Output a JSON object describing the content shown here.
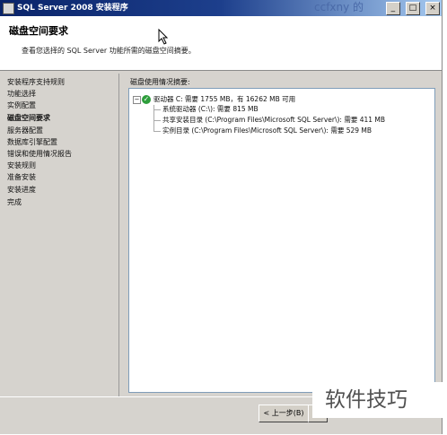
{
  "window": {
    "title": "SQL Server 2008 安装程序",
    "controls": [
      "_",
      "□",
      "×"
    ]
  },
  "watermark": {
    "top": "ccfxny 的 ",
    "bottom": "软件技巧"
  },
  "header": {
    "title": "磁盘空间要求",
    "subtitle": "查看您选择的 SQL Server 功能所需的磁盘空间摘要。"
  },
  "sidebar": {
    "items": [
      {
        "label": "安装程序支持规则",
        "active": false
      },
      {
        "label": "功能选择",
        "active": false
      },
      {
        "label": "实例配置",
        "active": false
      },
      {
        "label": "磁盘空间要求",
        "active": true
      },
      {
        "label": "服务器配置",
        "active": false
      },
      {
        "label": "数据库引擎配置",
        "active": false
      },
      {
        "label": "错误和使用情况报告",
        "active": false
      },
      {
        "label": "安装规则",
        "active": false
      },
      {
        "label": "准备安装",
        "active": false
      },
      {
        "label": "安装进度",
        "active": false
      },
      {
        "label": "完成",
        "active": false
      }
    ]
  },
  "main": {
    "summary_label": "磁盘使用情况摘要:",
    "tree": {
      "root": "驱动器 C: 需要 1755 MB，有 16262 MB 可用",
      "children": [
        "系统驱动器 (C:\\): 需要 815 MB",
        "共享安装目录 (C:\\Program Files\\Microsoft SQL Server\\): 需要 411 MB",
        "实例目录 (C:\\Program Files\\Microsoft SQL Server\\): 需要 529 MB"
      ]
    }
  },
  "footer": {
    "back_label": "< 上一步(B)",
    "next_label": "下"
  },
  "colors": {
    "titlebar": "#0a246a",
    "check": "#2e9e3c"
  }
}
